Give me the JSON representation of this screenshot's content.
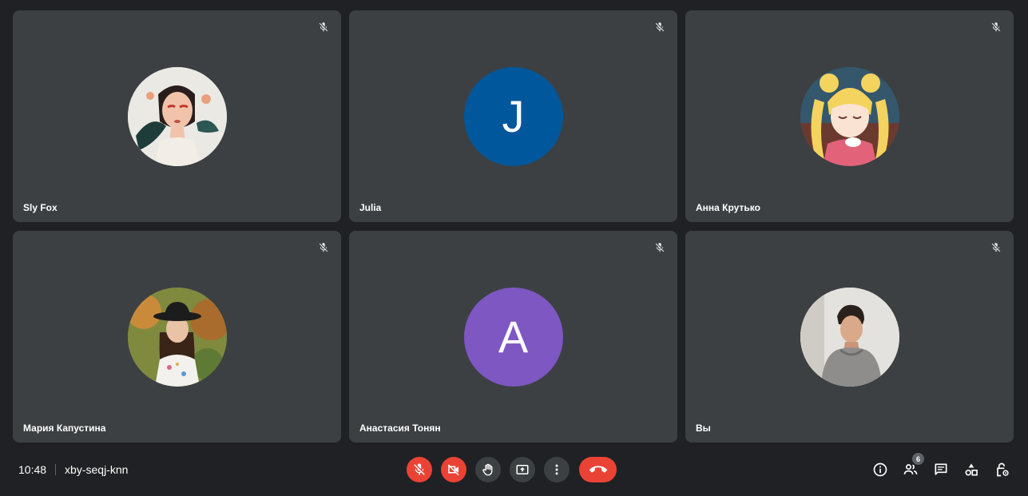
{
  "participants": [
    {
      "name": "Sly Fox",
      "avatar": "illustrated-girl-portrait",
      "muted": true
    },
    {
      "name": "Julia",
      "avatar_letter": "J",
      "avatar_color": "#01579b",
      "muted": true
    },
    {
      "name": "Анна Крутько",
      "avatar": "anime-girl-with-teacup",
      "muted": true
    },
    {
      "name": "Мария Капустина",
      "avatar": "woman-in-hat-photo",
      "muted": true
    },
    {
      "name": "Анастасия Тонян",
      "avatar_letter": "A",
      "avatar_color": "#7e57c2",
      "muted": true
    },
    {
      "name": "Вы",
      "avatar": "man-in-hoodie-photo",
      "muted": true
    }
  ],
  "bottom_bar": {
    "time": "10:48",
    "meeting_code": "xby-seqj-knn",
    "controls": [
      {
        "icon": "mic-off-icon",
        "state": "off",
        "color": "#ea4335"
      },
      {
        "icon": "camera-off-icon",
        "state": "off",
        "color": "#ea4335"
      },
      {
        "icon": "raise-hand-icon"
      },
      {
        "icon": "present-screen-icon"
      },
      {
        "icon": "more-options-icon"
      },
      {
        "icon": "end-call-icon",
        "color": "#ea4335"
      }
    ],
    "right_icons": [
      "info-icon",
      "people-icon",
      "chat-icon",
      "activities-icon",
      "host-controls-icon"
    ],
    "people_count": "6"
  },
  "colors": {
    "background": "#202124",
    "tile": "#3c4043",
    "danger": "#ea4335"
  }
}
